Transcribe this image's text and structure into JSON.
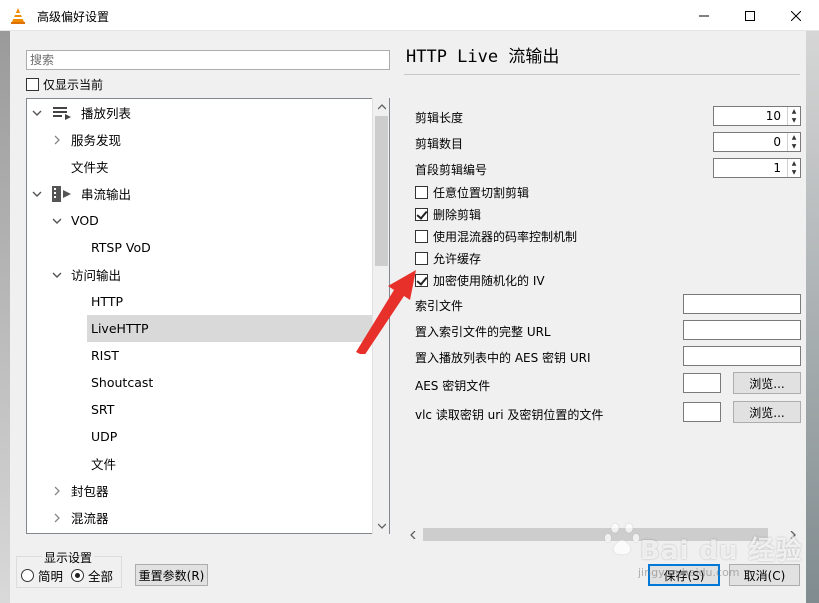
{
  "window": {
    "title": "高级偏好设置",
    "accent_color": "#0078d7"
  },
  "sidebar": {
    "search_placeholder": "搜索",
    "show_current_label": "仅显示当前",
    "tree": [
      {
        "label": "播放列表",
        "icon": "playlist-icon",
        "expanded": true
      },
      {
        "label": "服务发现",
        "expanded": false
      },
      {
        "label": "文件夹"
      },
      {
        "label": "串流输出",
        "icon": "stream-output-icon",
        "expanded": true
      },
      {
        "label": "VOD",
        "expanded": true
      },
      {
        "label": "RTSP VoD"
      },
      {
        "label": "访问输出",
        "expanded": true
      },
      {
        "label": "HTTP"
      },
      {
        "label": "LiveHTTP",
        "selected": true
      },
      {
        "label": "RIST"
      },
      {
        "label": "Shoutcast"
      },
      {
        "label": "SRT"
      },
      {
        "label": "UDP"
      },
      {
        "label": "文件"
      },
      {
        "label": "封包器",
        "expanded": false
      },
      {
        "label": "混流器",
        "expanded": false
      }
    ]
  },
  "display": {
    "legend": "显示设置",
    "simple_label": "简明",
    "all_label": "全部",
    "selected": "全部"
  },
  "buttons": {
    "reset": "重置参数(R)",
    "save": "保存(S)",
    "cancel": "取消(C)",
    "browse": "浏览..."
  },
  "panel": {
    "title": "HTTP Live 流输出",
    "fields": [
      {
        "label": "剪辑长度",
        "value": "10"
      },
      {
        "label": "剪辑数目",
        "value": "0"
      },
      {
        "label": "首段剪辑编号",
        "value": "1"
      }
    ],
    "options": [
      {
        "label": "任意位置切割剪辑",
        "checked": false
      },
      {
        "label": "删除剪辑",
        "checked": true
      },
      {
        "label": "使用混流器的码率控制机制",
        "checked": false
      },
      {
        "label": "允许缓存",
        "checked": false
      },
      {
        "label": "加密使用随机化的 IV",
        "checked": true
      }
    ],
    "text_fields": [
      {
        "label": "索引文件"
      },
      {
        "label": "置入索引文件的完整 URL"
      },
      {
        "label": "置入播放列表中的 AES 密钥 URI"
      }
    ],
    "file_fields": [
      {
        "label": "AES 密钥文件"
      },
      {
        "label": "vlc 读取密钥 uri 及密钥位置的文件"
      }
    ]
  },
  "watermark": {
    "brand": "Bai du 经验",
    "url": "jingyan.baidu.com"
  }
}
